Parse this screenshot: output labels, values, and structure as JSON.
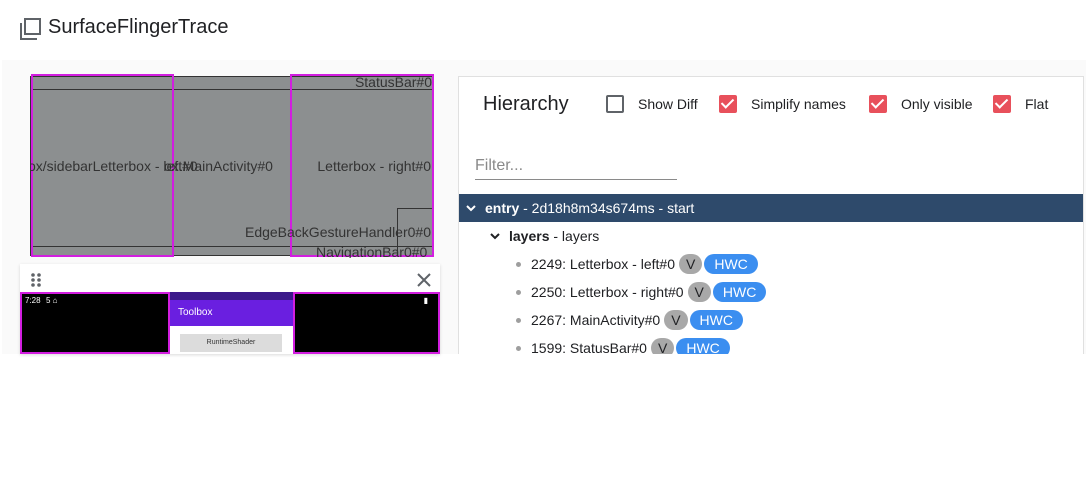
{
  "header": {
    "title": "SurfaceFlingerTrace",
    "icon": "copy-icon"
  },
  "rects_view": {
    "status_bar_label": "StatusBar#0",
    "left_overlap_label": "ox/sidebarLetterbox - left#0",
    "letterbox_left_label": "Letterbox - left#0",
    "main_activity_label": "ox.MainActivity#0",
    "letterbox_right_label": "Letterbox - right#0",
    "gesture_label": "EdgeBackGestureHandler0#0",
    "nav_bar_label": "NavigationBar0#0",
    "highlight_color": "#d21ee0"
  },
  "screenshot": {
    "status_time": "7:28",
    "status_icons": "5 ⌂",
    "battery": "▮",
    "toolbar_title": "Toolbox",
    "button_label": "RuntimeShader",
    "accent_color": "#6a1fe0"
  },
  "hierarchy": {
    "title": "Hierarchy",
    "options": [
      {
        "label": "Show Diff",
        "checked": false
      },
      {
        "label": "Simplify names",
        "checked": true
      },
      {
        "label": "Only visible",
        "checked": true
      },
      {
        "label": "Flat",
        "checked": true
      }
    ],
    "filter_placeholder": "Filter...",
    "entry": {
      "name": "entry",
      "detail": " - 2d18h8m34s674ms - start"
    },
    "layers_node": {
      "name": "layers",
      "detail": " - layers"
    },
    "rows": [
      {
        "label": "2249: Letterbox - left#0",
        "v": "V",
        "hwc": "HWC"
      },
      {
        "label": "2250: Letterbox - right#0",
        "v": "V",
        "hwc": "HWC"
      },
      {
        "label": "2267: MainActivity#0",
        "v": "V",
        "hwc": "HWC"
      },
      {
        "label": "1599: StatusBar#0",
        "v": "V",
        "hwc": "HWC"
      }
    ]
  }
}
